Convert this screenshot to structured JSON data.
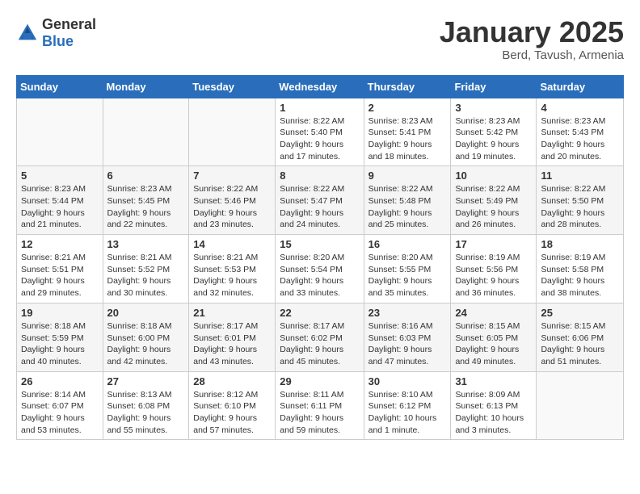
{
  "logo": {
    "general": "General",
    "blue": "Blue"
  },
  "title": "January 2025",
  "location": "Berd, Tavush, Armenia",
  "days_header": [
    "Sunday",
    "Monday",
    "Tuesday",
    "Wednesday",
    "Thursday",
    "Friday",
    "Saturday"
  ],
  "weeks": [
    [
      {
        "num": "",
        "info": ""
      },
      {
        "num": "",
        "info": ""
      },
      {
        "num": "",
        "info": ""
      },
      {
        "num": "1",
        "info": "Sunrise: 8:22 AM\nSunset: 5:40 PM\nDaylight: 9 hours and 17 minutes."
      },
      {
        "num": "2",
        "info": "Sunrise: 8:23 AM\nSunset: 5:41 PM\nDaylight: 9 hours and 18 minutes."
      },
      {
        "num": "3",
        "info": "Sunrise: 8:23 AM\nSunset: 5:42 PM\nDaylight: 9 hours and 19 minutes."
      },
      {
        "num": "4",
        "info": "Sunrise: 8:23 AM\nSunset: 5:43 PM\nDaylight: 9 hours and 20 minutes."
      }
    ],
    [
      {
        "num": "5",
        "info": "Sunrise: 8:23 AM\nSunset: 5:44 PM\nDaylight: 9 hours and 21 minutes."
      },
      {
        "num": "6",
        "info": "Sunrise: 8:23 AM\nSunset: 5:45 PM\nDaylight: 9 hours and 22 minutes."
      },
      {
        "num": "7",
        "info": "Sunrise: 8:22 AM\nSunset: 5:46 PM\nDaylight: 9 hours and 23 minutes."
      },
      {
        "num": "8",
        "info": "Sunrise: 8:22 AM\nSunset: 5:47 PM\nDaylight: 9 hours and 24 minutes."
      },
      {
        "num": "9",
        "info": "Sunrise: 8:22 AM\nSunset: 5:48 PM\nDaylight: 9 hours and 25 minutes."
      },
      {
        "num": "10",
        "info": "Sunrise: 8:22 AM\nSunset: 5:49 PM\nDaylight: 9 hours and 26 minutes."
      },
      {
        "num": "11",
        "info": "Sunrise: 8:22 AM\nSunset: 5:50 PM\nDaylight: 9 hours and 28 minutes."
      }
    ],
    [
      {
        "num": "12",
        "info": "Sunrise: 8:21 AM\nSunset: 5:51 PM\nDaylight: 9 hours and 29 minutes."
      },
      {
        "num": "13",
        "info": "Sunrise: 8:21 AM\nSunset: 5:52 PM\nDaylight: 9 hours and 30 minutes."
      },
      {
        "num": "14",
        "info": "Sunrise: 8:21 AM\nSunset: 5:53 PM\nDaylight: 9 hours and 32 minutes."
      },
      {
        "num": "15",
        "info": "Sunrise: 8:20 AM\nSunset: 5:54 PM\nDaylight: 9 hours and 33 minutes."
      },
      {
        "num": "16",
        "info": "Sunrise: 8:20 AM\nSunset: 5:55 PM\nDaylight: 9 hours and 35 minutes."
      },
      {
        "num": "17",
        "info": "Sunrise: 8:19 AM\nSunset: 5:56 PM\nDaylight: 9 hours and 36 minutes."
      },
      {
        "num": "18",
        "info": "Sunrise: 8:19 AM\nSunset: 5:58 PM\nDaylight: 9 hours and 38 minutes."
      }
    ],
    [
      {
        "num": "19",
        "info": "Sunrise: 8:18 AM\nSunset: 5:59 PM\nDaylight: 9 hours and 40 minutes."
      },
      {
        "num": "20",
        "info": "Sunrise: 8:18 AM\nSunset: 6:00 PM\nDaylight: 9 hours and 42 minutes."
      },
      {
        "num": "21",
        "info": "Sunrise: 8:17 AM\nSunset: 6:01 PM\nDaylight: 9 hours and 43 minutes."
      },
      {
        "num": "22",
        "info": "Sunrise: 8:17 AM\nSunset: 6:02 PM\nDaylight: 9 hours and 45 minutes."
      },
      {
        "num": "23",
        "info": "Sunrise: 8:16 AM\nSunset: 6:03 PM\nDaylight: 9 hours and 47 minutes."
      },
      {
        "num": "24",
        "info": "Sunrise: 8:15 AM\nSunset: 6:05 PM\nDaylight: 9 hours and 49 minutes."
      },
      {
        "num": "25",
        "info": "Sunrise: 8:15 AM\nSunset: 6:06 PM\nDaylight: 9 hours and 51 minutes."
      }
    ],
    [
      {
        "num": "26",
        "info": "Sunrise: 8:14 AM\nSunset: 6:07 PM\nDaylight: 9 hours and 53 minutes."
      },
      {
        "num": "27",
        "info": "Sunrise: 8:13 AM\nSunset: 6:08 PM\nDaylight: 9 hours and 55 minutes."
      },
      {
        "num": "28",
        "info": "Sunrise: 8:12 AM\nSunset: 6:10 PM\nDaylight: 9 hours and 57 minutes."
      },
      {
        "num": "29",
        "info": "Sunrise: 8:11 AM\nSunset: 6:11 PM\nDaylight: 9 hours and 59 minutes."
      },
      {
        "num": "30",
        "info": "Sunrise: 8:10 AM\nSunset: 6:12 PM\nDaylight: 10 hours and 1 minute."
      },
      {
        "num": "31",
        "info": "Sunrise: 8:09 AM\nSunset: 6:13 PM\nDaylight: 10 hours and 3 minutes."
      },
      {
        "num": "",
        "info": ""
      }
    ]
  ]
}
